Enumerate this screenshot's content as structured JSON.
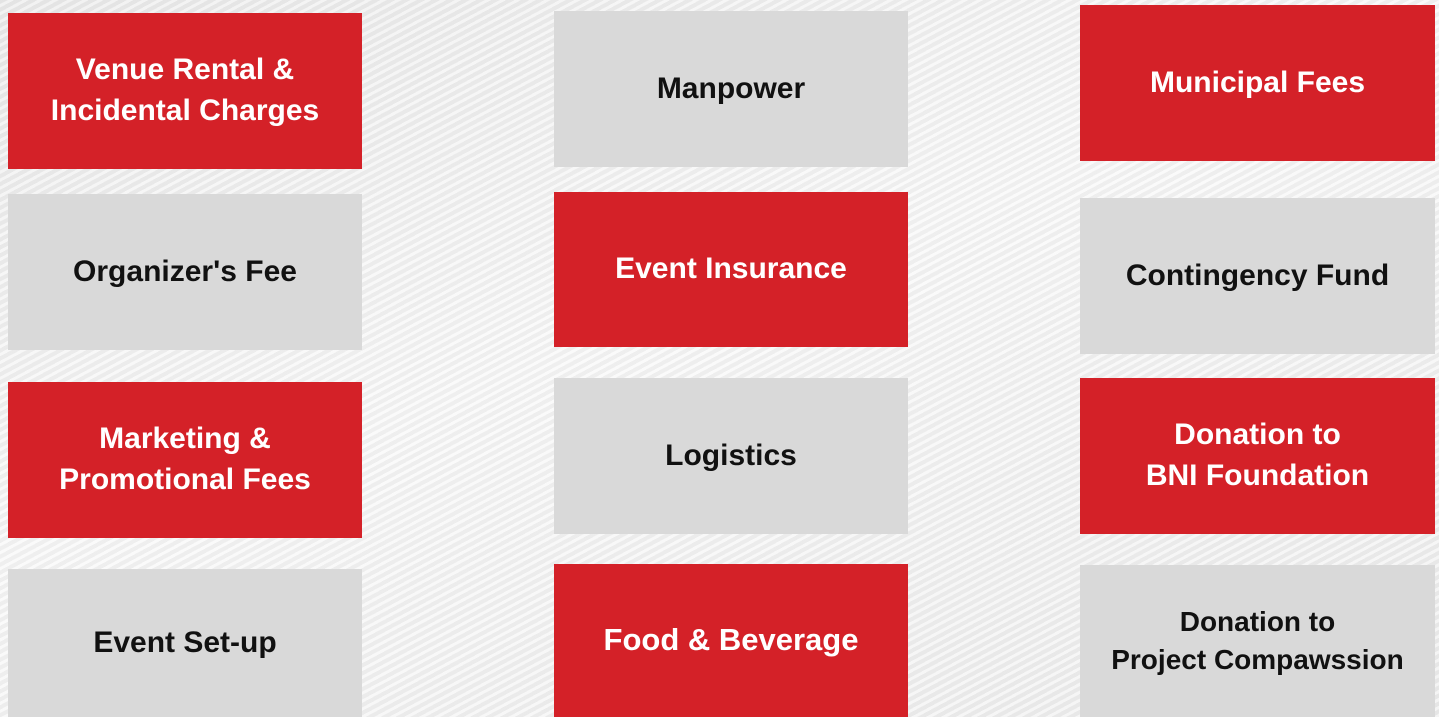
{
  "tiles": {
    "venue_rental": "Venue Rental &\nIncidental Charges",
    "manpower": "Manpower",
    "municipal_fees": "Municipal Fees",
    "organizers_fee": "Organizer's Fee",
    "event_insurance": "Event Insurance",
    "contingency_fund": "Contingency Fund",
    "marketing": "Marketing &\nPromotional Fees",
    "logistics": "Logistics",
    "donation_bni": "Donation to\nBNI Foundation",
    "event_setup": "Event Set-up",
    "food_beverage": "Food & Beverage",
    "donation_project": "Donation to\nProject Compawssion"
  },
  "colors": {
    "red": "#d42128",
    "grey": "#d9d9d9",
    "red_text": "#ffffff",
    "grey_text": "#111111"
  }
}
